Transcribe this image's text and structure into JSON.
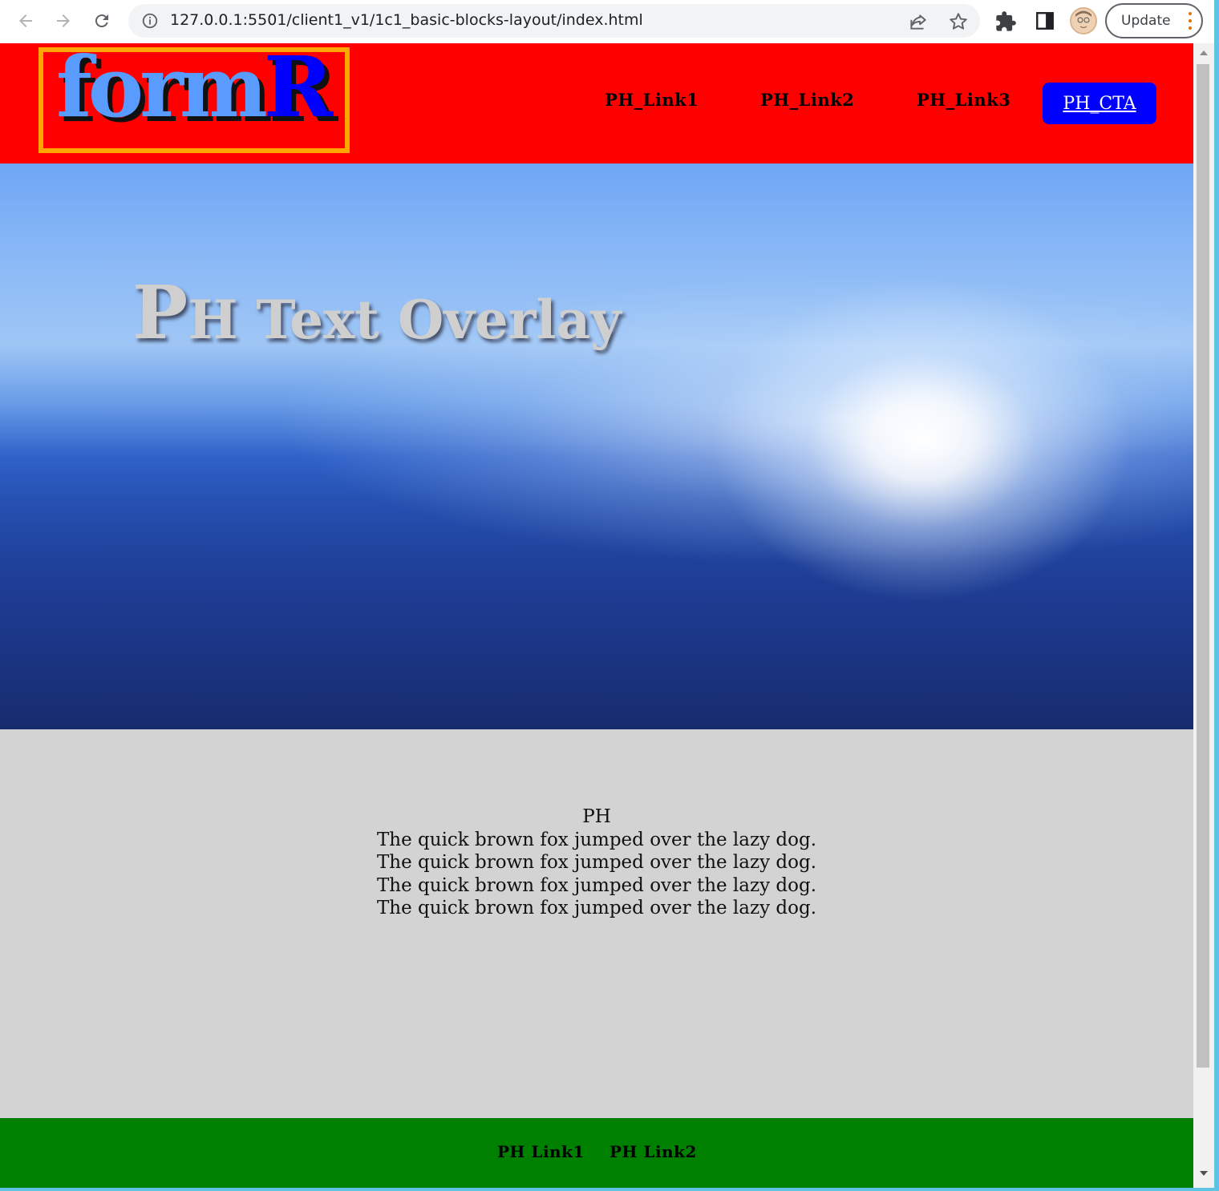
{
  "browser": {
    "url": "127.0.0.1:5501/client1_v1/1c1_basic-blocks-layout/index.html",
    "update_label": "Update",
    "icons": {
      "back": "back-arrow-icon",
      "forward": "forward-arrow-icon",
      "reload": "reload-icon",
      "info": "info-icon",
      "share": "share-icon",
      "bookmark": "star-icon",
      "extensions": "puzzle-icon",
      "side_panel": "side-panel-icon",
      "profile": "avatar",
      "menu": "kebab-menu-icon"
    }
  },
  "header": {
    "logo_part1": "form",
    "logo_part2": "R",
    "nav": [
      {
        "label": "PH_Link1"
      },
      {
        "label": "PH_Link2"
      },
      {
        "label": "PH_Link3"
      }
    ],
    "cta_label": "PH_CTA",
    "colors": {
      "background": "#ff0000",
      "logo_border": "#ffa500",
      "logo_light": "#5a9bff",
      "logo_dark": "#0000ff",
      "cta_background": "#0000ff"
    }
  },
  "hero": {
    "title_first_letter": "P",
    "title_rest": "H Text Overlay"
  },
  "content": {
    "heading": "PH",
    "lines": [
      "The quick brown fox jumped over the lazy dog.",
      "The quick brown fox jumped over the lazy dog.",
      "The quick brown fox jumped over the lazy dog.",
      "The quick brown fox jumped over the lazy dog."
    ],
    "background": "#d3d3d3"
  },
  "footer": {
    "links": [
      {
        "label": "PH Link1"
      },
      {
        "label": "PH Link2"
      }
    ],
    "background": "#008000"
  }
}
